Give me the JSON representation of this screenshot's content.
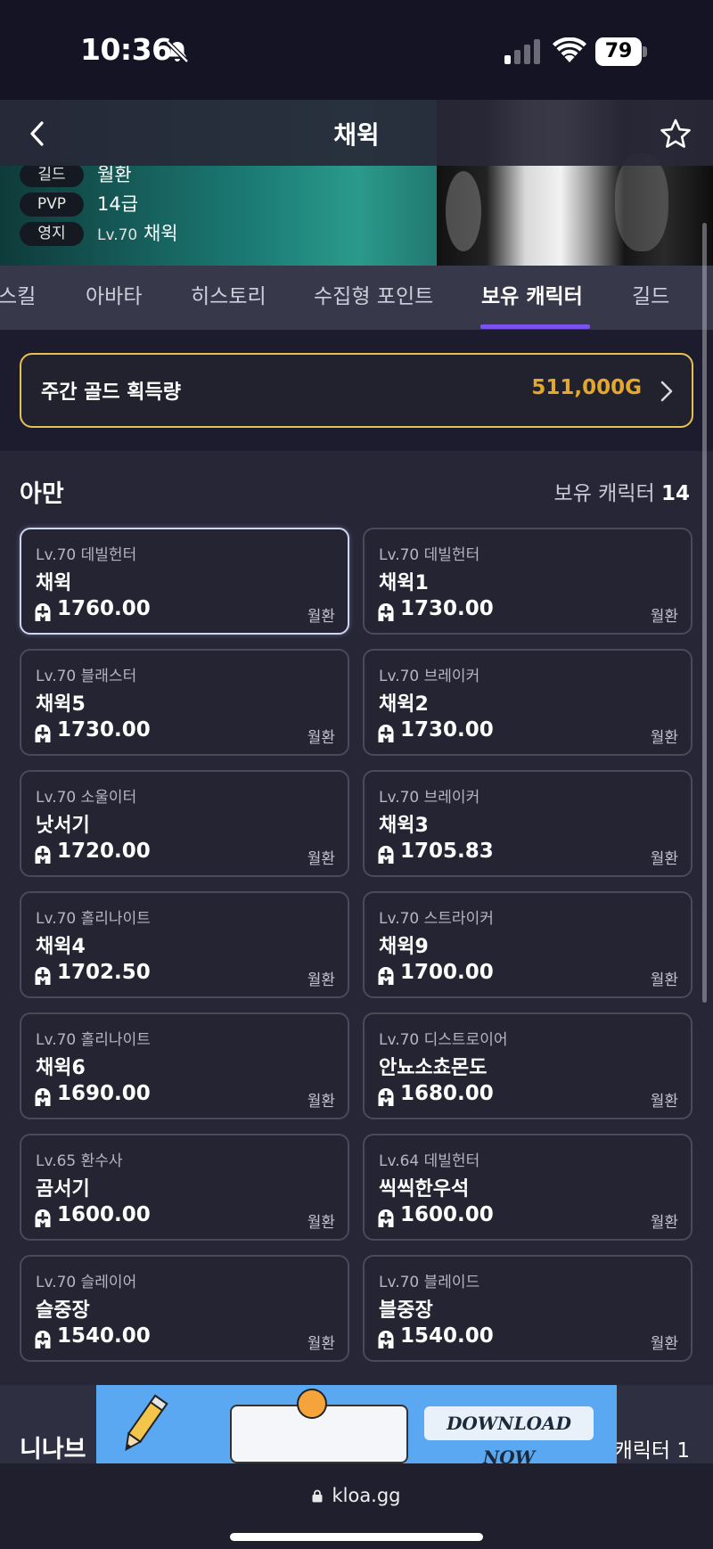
{
  "status_bar": {
    "time": "10:36",
    "battery": "79"
  },
  "header": {
    "title": "채윅",
    "info": [
      {
        "key": "길드",
        "value": "월환"
      },
      {
        "key": "PVP",
        "value": "14급"
      },
      {
        "key": "영지",
        "level": "Lv.70",
        "value": "채윅"
      }
    ]
  },
  "tabs": [
    "스킬",
    "아바타",
    "히스토리",
    "수집형 포인트",
    "보유 캐릭터",
    "길드"
  ],
  "active_tab": "보유 캐릭터",
  "gold": {
    "label": "주간 골드 획득량",
    "value": "511,000G"
  },
  "roster": {
    "server": "아만",
    "owned_label": "보유 캐릭터",
    "owned_count": "14",
    "characters": [
      {
        "cls": "Lv.70 데빌헌터",
        "name": "채윅",
        "ilvl": "1760.00",
        "guild": "월환"
      },
      {
        "cls": "Lv.70 데빌헌터",
        "name": "채윅1",
        "ilvl": "1730.00",
        "guild": "월환"
      },
      {
        "cls": "Lv.70 블래스터",
        "name": "채윅5",
        "ilvl": "1730.00",
        "guild": "월환"
      },
      {
        "cls": "Lv.70 브레이커",
        "name": "채윅2",
        "ilvl": "1730.00",
        "guild": "월환"
      },
      {
        "cls": "Lv.70 소울이터",
        "name": "낫서기",
        "ilvl": "1720.00",
        "guild": "월환"
      },
      {
        "cls": "Lv.70 브레이커",
        "name": "채윅3",
        "ilvl": "1705.83",
        "guild": "월환"
      },
      {
        "cls": "Lv.70 홀리나이트",
        "name": "채윅4",
        "ilvl": "1702.50",
        "guild": "월환"
      },
      {
        "cls": "Lv.70 스트라이커",
        "name": "채윅9",
        "ilvl": "1700.00",
        "guild": "월환"
      },
      {
        "cls": "Lv.70 홀리나이트",
        "name": "채윅6",
        "ilvl": "1690.00",
        "guild": "월환"
      },
      {
        "cls": "Lv.70 디스트로이어",
        "name": "안뇨소쵸몬도",
        "ilvl": "1680.00",
        "guild": "월환"
      },
      {
        "cls": "Lv.65 환수사",
        "name": "곰서기",
        "ilvl": "1600.00",
        "guild": "월환"
      },
      {
        "cls": "Lv.64 데빌헌터",
        "name": "씩씩한우석",
        "ilvl": "1600.00",
        "guild": "월환"
      },
      {
        "cls": "Lv.70 슬레이어",
        "name": "슬중장",
        "ilvl": "1540.00",
        "guild": "월환"
      },
      {
        "cls": "Lv.70 블레이드",
        "name": "블중장",
        "ilvl": "1540.00",
        "guild": "월환"
      }
    ]
  },
  "next_section": {
    "server": "니나브",
    "owned_label": "캐릭터 1"
  },
  "ad": {
    "cta": "DOWNLOAD NOW"
  },
  "browser": {
    "url": "kloa.gg"
  },
  "colors": {
    "accent": "#7b52f0",
    "gold": "#e5a82c",
    "gold_border": "#e8c24e",
    "background": "#262636"
  },
  "icons": [
    "bell-off-icon",
    "signal-icon",
    "wifi-icon",
    "battery-icon",
    "back-arrow-icon",
    "star-icon",
    "chevron-right-icon",
    "helmet-icon",
    "lock-icon"
  ]
}
